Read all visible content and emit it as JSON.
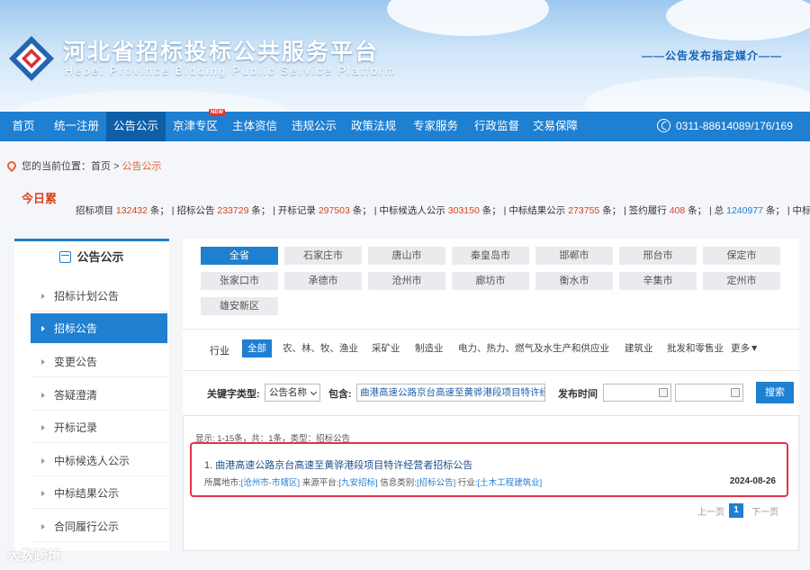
{
  "header": {
    "title_cn": "河北省招标投标公共服务平台",
    "title_en": "Hebei Province Bidding Public Service Platform",
    "slogan": "——公告发布指定媒介——"
  },
  "nav": {
    "items": [
      {
        "label": "首页"
      },
      {
        "label": "统一注册"
      },
      {
        "label": "公告公示",
        "active": true
      },
      {
        "label": "京津专区",
        "badge": "NEW"
      },
      {
        "label": "主体资信"
      },
      {
        "label": "违规公示"
      },
      {
        "label": "政策法规"
      },
      {
        "label": "专家服务"
      },
      {
        "label": "行政监督"
      },
      {
        "label": "交易保障"
      }
    ],
    "phone": "0311-88614089/176/169"
  },
  "breadcrumb": {
    "prefix": "您的当前位置：",
    "home": "首页",
    "sep": ">",
    "current": "公告公示"
  },
  "stats": {
    "today_label": "今日累",
    "items": [
      {
        "label": "招标项目",
        "value": "132432",
        "unit": "条；"
      },
      {
        "label": "招标公告",
        "value": "233729",
        "unit": "条；"
      },
      {
        "label": "开标记录",
        "value": "297503",
        "unit": "条；"
      },
      {
        "label": "中标候选人公示",
        "value": "303150",
        "unit": "条；"
      },
      {
        "label": "中标结果公示",
        "value": "273755",
        "unit": "条；"
      },
      {
        "label": "签约履行",
        "value": "408",
        "unit": "条；"
      },
      {
        "label": "总",
        "value": "1240977",
        "unit": "条；"
      },
      {
        "label": "中标金额",
        "value": "",
        "unit": ""
      }
    ]
  },
  "sidebar": {
    "title": "公告公示",
    "items": [
      {
        "label": "招标计划公告"
      },
      {
        "label": "招标公告",
        "active": true
      },
      {
        "label": "变更公告"
      },
      {
        "label": "答疑澄清"
      },
      {
        "label": "开标记录"
      },
      {
        "label": "中标候选人公示"
      },
      {
        "label": "中标结果公示"
      },
      {
        "label": "合同履行公示"
      }
    ]
  },
  "filters": {
    "cities": [
      "全省",
      "石家庄市",
      "唐山市",
      "秦皇岛市",
      "邯郸市",
      "邢台市",
      "保定市",
      "张家口市",
      "承德市",
      "沧州市",
      "廊坊市",
      "衡水市",
      "辛集市",
      "定州市",
      "雄安新区"
    ],
    "active_city": "全省",
    "industry_label": "行业",
    "industries": [
      "全部",
      "农、林、牧、渔业",
      "采矿业",
      "制造业",
      "电力、热力、燃气及水生产和供应业",
      "建筑业",
      "批发和零售业",
      "更多▼"
    ],
    "active_industry": "全部"
  },
  "search": {
    "keyword_type_label": "关键字类型:",
    "keyword_type_value": "公告名称",
    "contains_label": "包含:",
    "keyword_value": "曲港高速公路京台高速至黄骅港段项目特许经营",
    "date_label": "发布时间",
    "date_sep": "-",
    "button": "搜索"
  },
  "results": {
    "summary": "显示: 1-15条，共：1条，类型：招标公告",
    "items": [
      {
        "title": "1. 曲港高速公路京台高速至黄骅港段项目特许经营者招标公告",
        "region_label": "所属地市:",
        "region": "[沧州市-市辖区]",
        "source_label": "来源平台:",
        "source": "[九安招标]",
        "info_label": "信息类别:",
        "info": "[招标公告]",
        "industry_label": "行业:",
        "industry": "[土木工程建筑业]",
        "date": "2024-08-26"
      }
    ],
    "pager": {
      "prev": "上一页",
      "current": "1",
      "next": "下一页"
    }
  },
  "watermark": "大数跨境"
}
